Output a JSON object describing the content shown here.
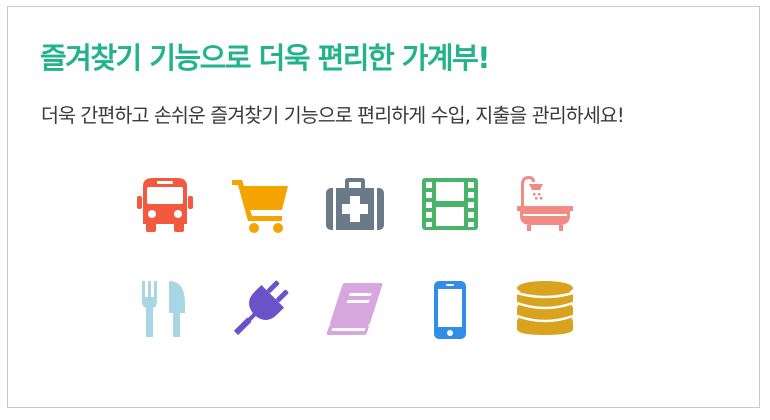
{
  "banner": {
    "title": "즐겨찾기 기능으로 더욱 편리한 가계부!",
    "subtitle": "더욱 간편하고 손쉬운 즐겨찾기 기능으로  편리하게 수입, 지출을 관리하세요!"
  },
  "icons": [
    {
      "name": "bus-icon",
      "color": "#f2593f"
    },
    {
      "name": "shopping-cart-icon",
      "color": "#f5a300"
    },
    {
      "name": "first-aid-kit-icon",
      "color": "#6b7a89"
    },
    {
      "name": "film-icon",
      "color": "#49b36a"
    },
    {
      "name": "bathtub-icon",
      "color": "#f28a86"
    },
    {
      "name": "fork-knife-icon",
      "color": "#a9d6e5"
    },
    {
      "name": "plug-icon",
      "color": "#6a52c8"
    },
    {
      "name": "book-icon",
      "color": "#d9a7e0"
    },
    {
      "name": "smartphone-icon",
      "color": "#2f8fe8"
    },
    {
      "name": "coins-icon",
      "color": "#d9a21f"
    }
  ]
}
